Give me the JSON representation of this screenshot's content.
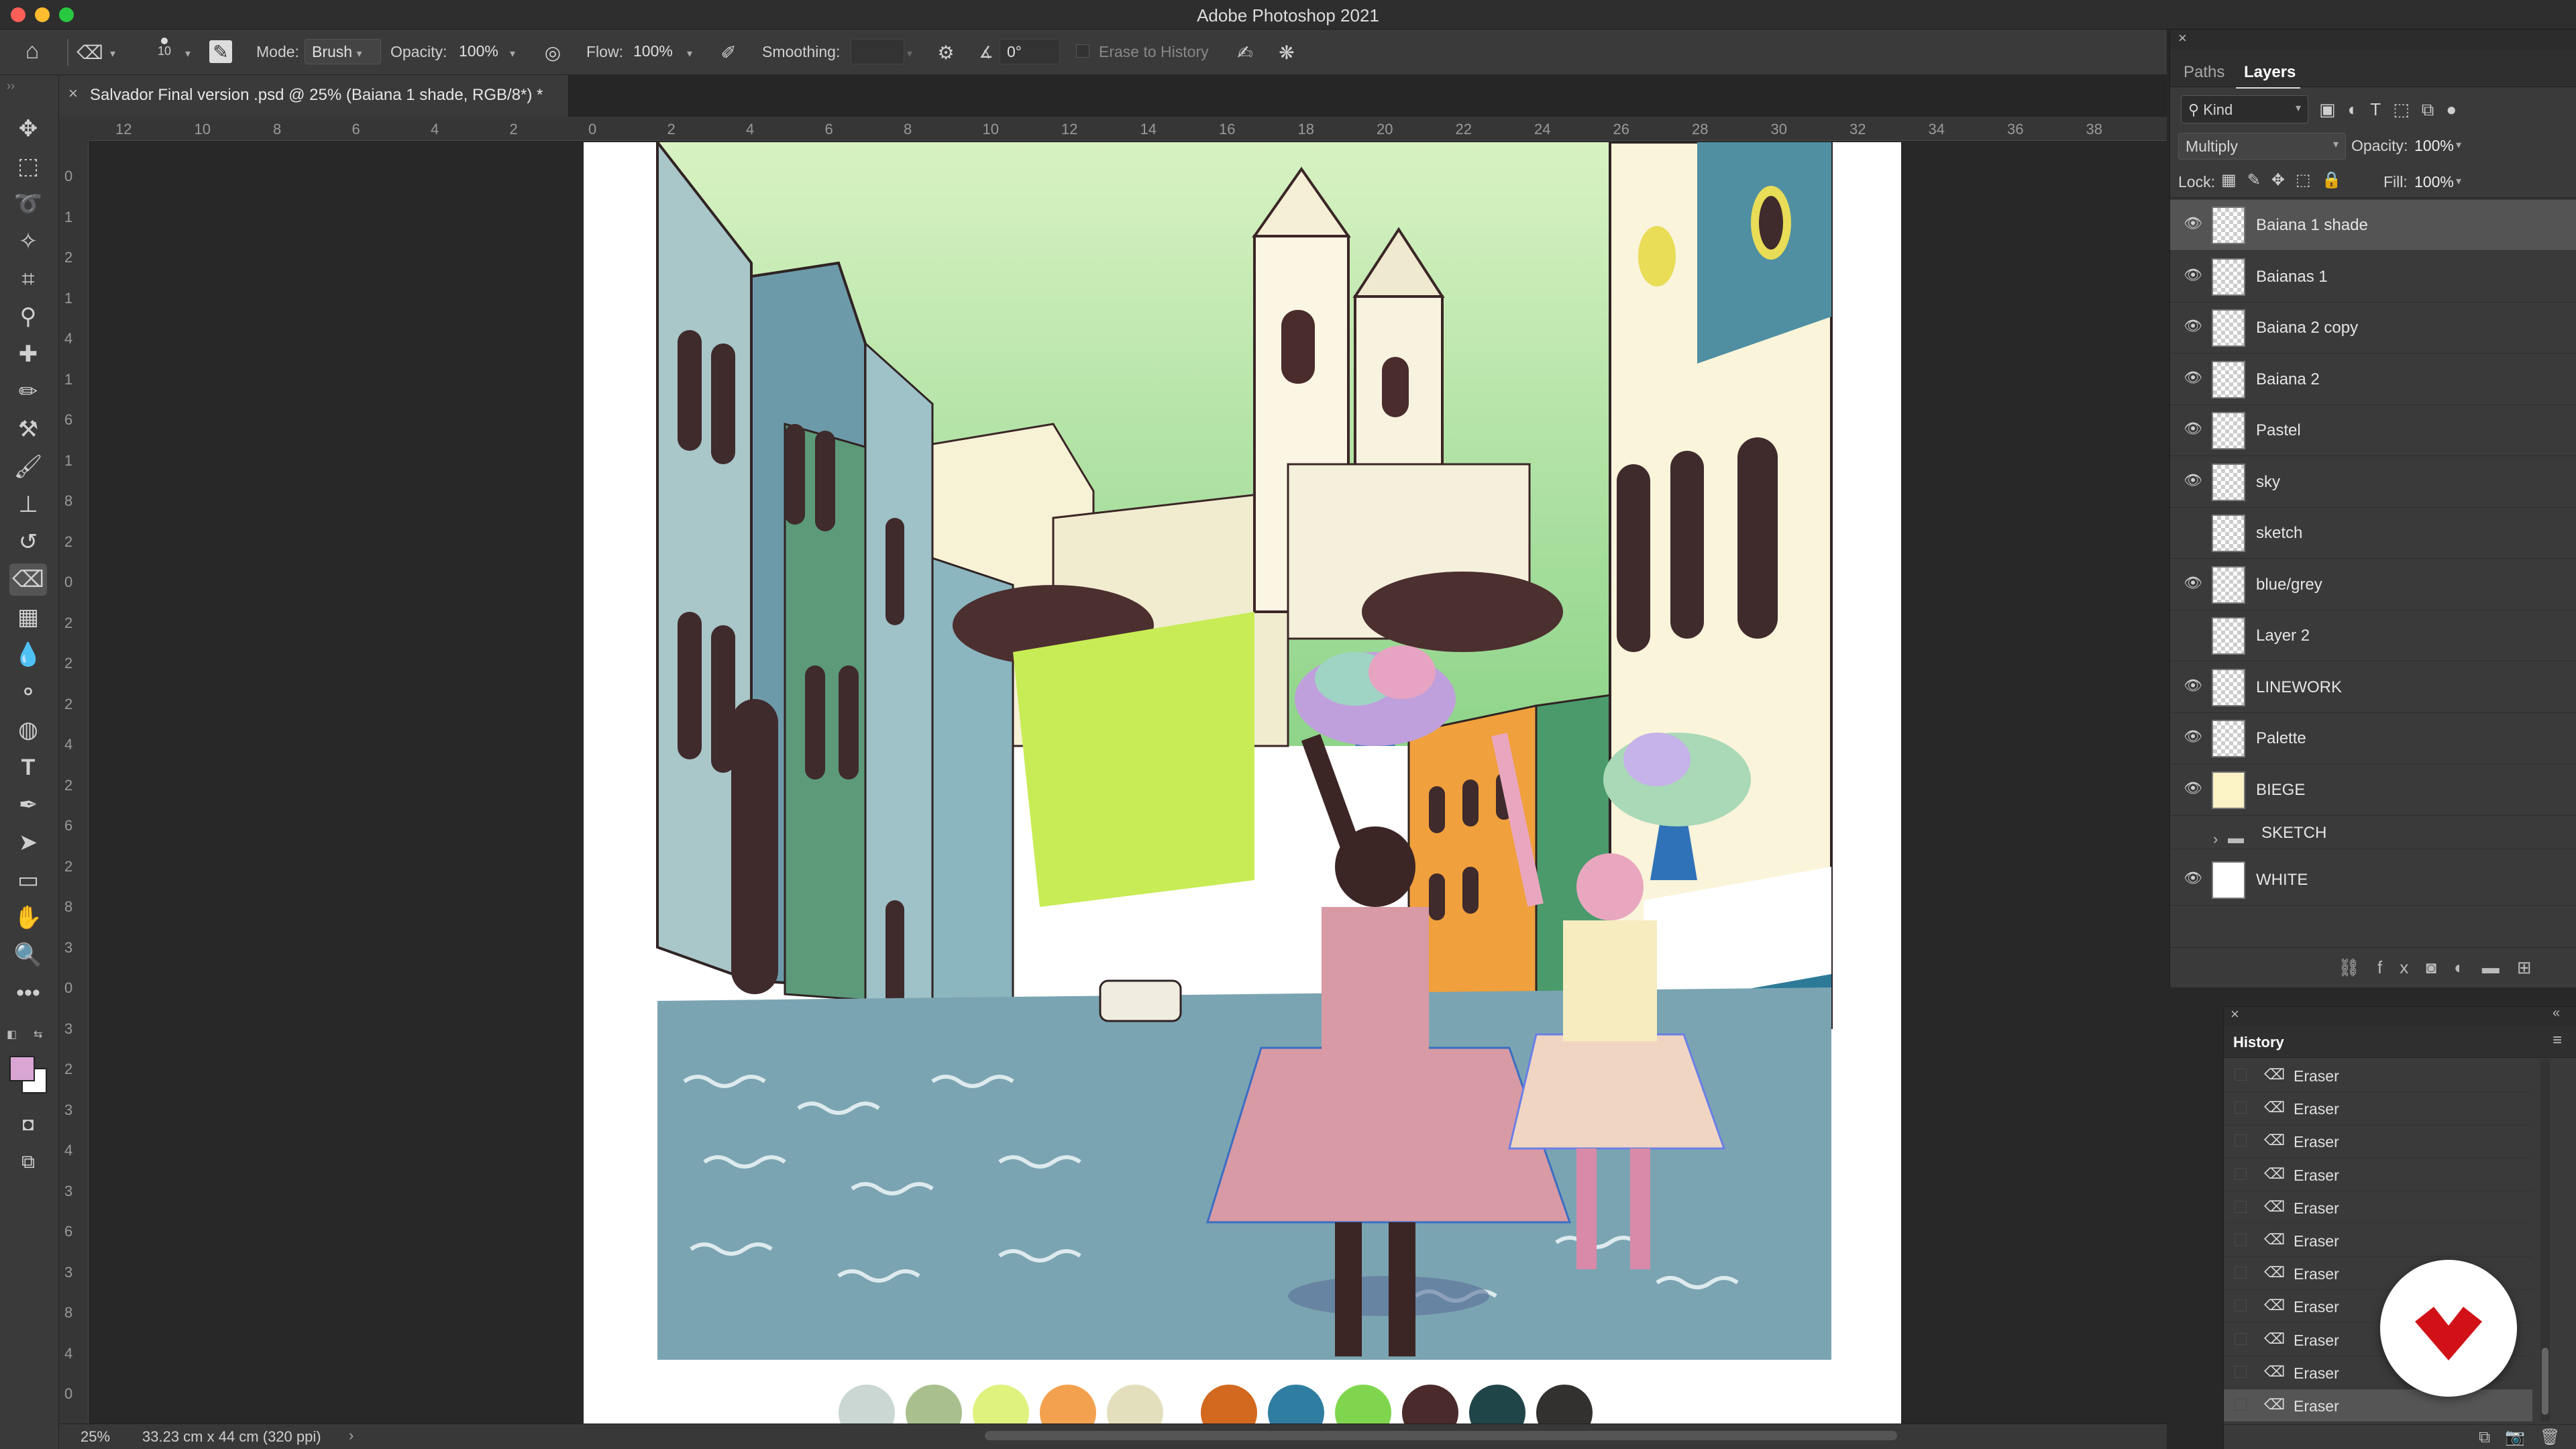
{
  "app": {
    "title": "Adobe Photoshop 2021"
  },
  "options_bar": {
    "brush_size": "10",
    "mode_label": "Mode:",
    "mode_value": "Brush",
    "opacity_label": "Opacity:",
    "opacity_value": "100%",
    "flow_label": "Flow:",
    "flow_value": "100%",
    "smoothing_label": "Smoothing:",
    "smoothing_value": "",
    "angle_value": "0°",
    "erase_to_history": "Erase to History"
  },
  "document": {
    "tab_title": "Salvador Final version .psd @ 25% (Baiana 1 shade, RGB/8*) *",
    "ruler_h_ticks": [
      "12",
      "10",
      "8",
      "6",
      "4",
      "2",
      "0",
      "2",
      "4",
      "6",
      "8",
      "10",
      "12",
      "14",
      "16",
      "18",
      "20",
      "22",
      "24",
      "26",
      "28",
      "30",
      "32",
      "34",
      "36",
      "38"
    ],
    "ruler_v_ticks": [
      "0",
      "1",
      "2",
      "1",
      "4",
      "1",
      "6",
      "1",
      "8",
      "2",
      "0",
      "2",
      "2",
      "2",
      "4",
      "2",
      "6",
      "2",
      "8",
      "3",
      "0",
      "3",
      "2",
      "3",
      "4",
      "3",
      "6",
      "3",
      "8",
      "4",
      "0"
    ]
  },
  "status_bar": {
    "zoom": "25%",
    "doc_size": "33.23 cm x 44 cm (320 ppi)"
  },
  "layers_panel": {
    "tabs": [
      "Paths",
      "Layers"
    ],
    "filter_kind": "Kind",
    "blend_mode": "Multiply",
    "opacity_label": "Opacity:",
    "opacity_value": "100%",
    "lock_label": "Lock:",
    "fill_label": "Fill:",
    "fill_value": "100%",
    "layers": [
      {
        "name": "Baiana 1 shade",
        "visible": true,
        "selected": true
      },
      {
        "name": "Baianas 1",
        "visible": true
      },
      {
        "name": "Baiana 2 copy",
        "visible": true
      },
      {
        "name": "Baiana 2",
        "visible": true
      },
      {
        "name": "Pastel",
        "visible": true
      },
      {
        "name": "sky",
        "visible": true
      },
      {
        "name": "sketch",
        "visible": false
      },
      {
        "name": "blue/grey",
        "visible": true
      },
      {
        "name": "Layer 2",
        "visible": false
      },
      {
        "name": "LINEWORK",
        "visible": true
      },
      {
        "name": "Palette",
        "visible": true
      },
      {
        "name": "BIEGE",
        "visible": true
      },
      {
        "name": "SKETCH",
        "visible": false,
        "group": true
      },
      {
        "name": "WHITE",
        "visible": true
      }
    ]
  },
  "history_panel": {
    "title": "History",
    "items": [
      "Eraser",
      "Eraser",
      "Eraser",
      "Eraser",
      "Eraser",
      "Eraser",
      "Eraser",
      "Eraser",
      "Eraser",
      "Eraser",
      "Eraser"
    ]
  },
  "palette_swatches": [
    "#cad7d3",
    "#a9c08e",
    "#dff27e",
    "#f4a14f",
    "#e3dfbd",
    "#d2691f",
    "#2f7ea1",
    "#7fd64e",
    "#4b2a2c",
    "#204548",
    "#333030"
  ],
  "colors": {
    "foreground": "#d9a6d4",
    "background": "#ffffff",
    "accent_logo": "#d11117"
  }
}
